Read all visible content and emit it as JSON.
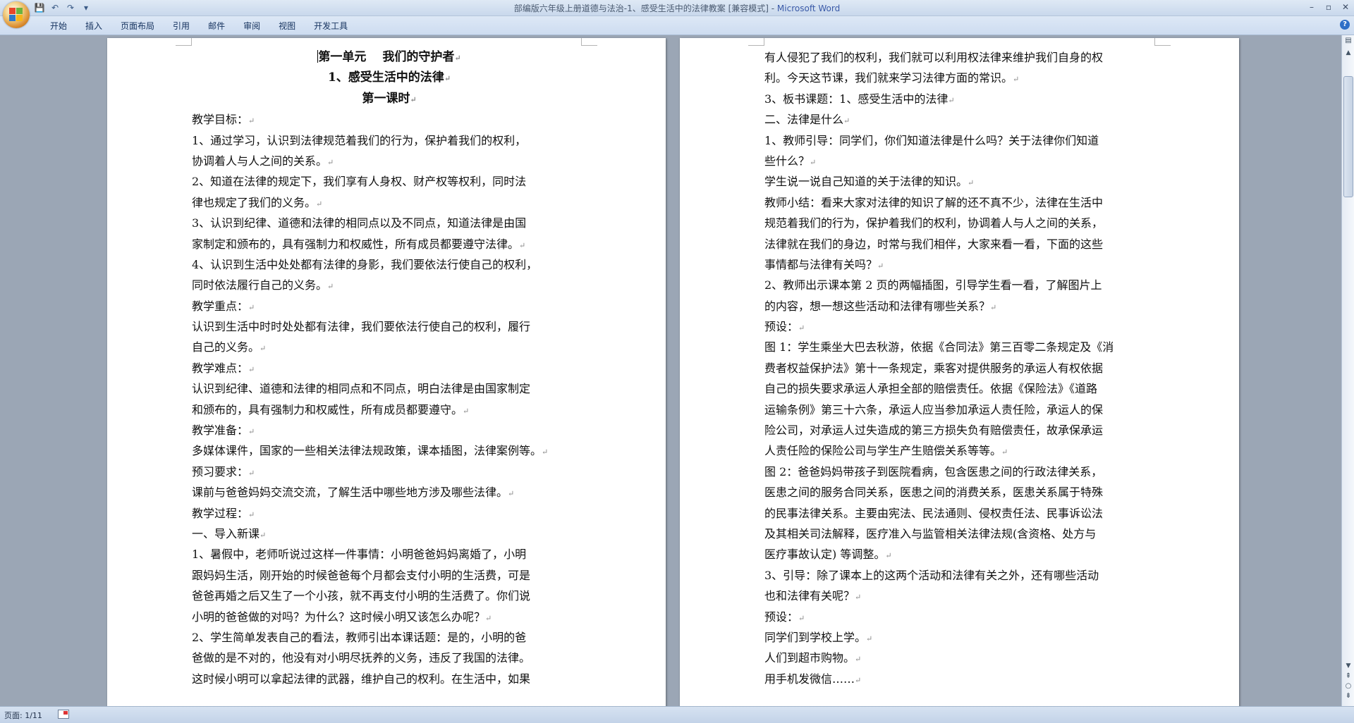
{
  "window": {
    "title_doc": "部编版六年级上册道德与法治-1、感受生活中的法律教案 [兼容模式]",
    "title_sep": " - ",
    "title_app": "Microsoft Word",
    "controls": {
      "minimize": "–",
      "restore": "▫",
      "close": "✕"
    }
  },
  "qat": {
    "save": "💾",
    "undo": "↶",
    "redo": "↷",
    "more": "▾"
  },
  "ribbon": {
    "tabs": [
      "开始",
      "插入",
      "页面布局",
      "引用",
      "邮件",
      "审阅",
      "视图",
      "开发工具"
    ],
    "help": "?"
  },
  "pages": {
    "left": [
      {
        "t": "第一单元　 我们的守护者",
        "c": true,
        "cursor": true
      },
      {
        "t": "1、感受生活中的法律",
        "c": true
      },
      {
        "t": "第一课时",
        "c": true
      },
      {
        "t": "教学目标："
      },
      {
        "t": "1、通过学习，认识到法律规范着我们的行为，保护着我们的权利，",
        "nomark": true
      },
      {
        "t": "协调着人与人之间的关系。"
      },
      {
        "t": "2、知道在法律的规定下，我们享有人身权、财产权等权利，同时法",
        "nomark": true
      },
      {
        "t": "律也规定了我们的义务。"
      },
      {
        "t": "3、认识到纪律、道德和法律的相同点以及不同点，知道法律是由国",
        "nomark": true
      },
      {
        "t": "家制定和颁布的，具有强制力和权威性，所有成员都要遵守法律。"
      },
      {
        "t": "4、认识到生活中处处都有法律的身影，我们要依法行使自己的权利，",
        "nomark": true
      },
      {
        "t": "同时依法履行自己的义务。"
      },
      {
        "t": "教学重点："
      },
      {
        "t": "认识到生活中时时处处都有法律，我们要依法行使自己的权利，履行",
        "nomark": true
      },
      {
        "t": "自己的义务。"
      },
      {
        "t": "教学难点："
      },
      {
        "t": "认识到纪律、道德和法律的相同点和不同点，明白法律是由国家制定",
        "nomark": true
      },
      {
        "t": "和颁布的，具有强制力和权威性，所有成员都要遵守。"
      },
      {
        "t": "教学准备："
      },
      {
        "t": "多媒体课件，国家的一些相关法律法规政策，课本插图，法律案例等。"
      },
      {
        "t": "预习要求："
      },
      {
        "t": "课前与爸爸妈妈交流交流，了解生活中哪些地方涉及哪些法律。"
      },
      {
        "t": "教学过程："
      },
      {
        "t": "一、导入新课"
      },
      {
        "t": "1、暑假中，老师听说过这样一件事情：小明爸爸妈妈离婚了，小明",
        "nomark": true
      },
      {
        "t": "跟妈妈生活，刚开始的时候爸爸每个月都会支付小明的生活费，可是",
        "nomark": true
      },
      {
        "t": "爸爸再婚之后又生了一个小孩，就不再支付小明的生活费了。你们说",
        "nomark": true
      },
      {
        "t": "小明的爸爸做的对吗？为什么？这时候小明又该怎么办呢？"
      },
      {
        "t": "2、学生简单发表自己的看法，教师引出本课话题：是的，小明的爸",
        "nomark": true
      },
      {
        "t": "爸做的是不对的，他没有对小明尽抚养的义务，违反了我国的法律。",
        "nomark": true
      },
      {
        "t": "这时候小明可以拿起法律的武器，维护自己的权利。在生活中，如果",
        "nomark": true
      }
    ],
    "right": [
      {
        "t": "有人侵犯了我们的权利，我们就可以利用权法律来维护我们自身的权",
        "nomark": true
      },
      {
        "t": "利。今天这节课，我们就来学习法律方面的常识。"
      },
      {
        "t": "3、板书课题：1、感受生活中的法律"
      },
      {
        "t": "二、法律是什么"
      },
      {
        "t": "1、教师引导：同学们，你们知道法律是什么吗？关于法律你们知道",
        "nomark": true
      },
      {
        "t": "些什么？"
      },
      {
        "t": "学生说一说自己知道的关于法律的知识。"
      },
      {
        "t": "教师小结：看来大家对法律的知识了解的还不真不少，法律在生活中",
        "nomark": true
      },
      {
        "t": "规范着我们的行为，保护着我们的权利，协调着人与人之间的关系，",
        "nomark": true
      },
      {
        "t": "法律就在我们的身边，时常与我们相伴，大家来看一看，下面的这些",
        "nomark": true
      },
      {
        "t": "事情都与法律有关吗？"
      },
      {
        "t": "2、教师出示课本第 2 页的两幅插图，引导学生看一看，了解图片上",
        "nomark": true
      },
      {
        "t": "的内容，想一想这些活动和法律有哪些关系？"
      },
      {
        "t": "预设："
      },
      {
        "t": "图 1：学生乘坐大巴去秋游，依据《合同法》第三百零二条规定及《消",
        "nomark": true
      },
      {
        "t": "费者权益保护法》第十一条规定，乘客对提供服务的承运人有权依据",
        "nomark": true
      },
      {
        "t": "自己的损失要求承运人承担全部的赔偿责任。依据《保险法》《道路",
        "nomark": true
      },
      {
        "t": "运输条例》第三十六条，承运人应当参加承运人责任险，承运人的保",
        "nomark": true
      },
      {
        "t": "险公司，对承运人过失造成的第三方损失负有赔偿责任，故承保承运",
        "nomark": true
      },
      {
        "t": "人责任险的保险公司与学生产生赔偿关系等等。"
      },
      {
        "t": "图 2：爸爸妈妈带孩子到医院看病，包含医患之间的行政法律关系，",
        "nomark": true
      },
      {
        "t": "医患之间的服务合同关系，医患之间的消费关系，医患关系属于特殊",
        "nomark": true
      },
      {
        "t": "的民事法律关系。主要由宪法、民法通则、侵权责任法、民事诉讼法",
        "nomark": true
      },
      {
        "t": "及其相关司法解释，医疗准入与监管相关法律法规(含资格、处方与",
        "nomark": true
      },
      {
        "t": "医疗事故认定) 等调整。"
      },
      {
        "t": "3、引导：除了课本上的这两个活动和法律有关之外，还有哪些活动",
        "nomark": true
      },
      {
        "t": "也和法律有关呢？"
      },
      {
        "t": "预设："
      },
      {
        "t": "同学们到学校上学。"
      },
      {
        "t": "人们到超市购物。"
      },
      {
        "t": "用手机发微信……"
      }
    ],
    "para_mark": "↵"
  },
  "statusbar": {
    "page": "页面: 1/11"
  },
  "colors": {
    "background": "#9ba6b5",
    "page": "#ffffff",
    "title_app": "#3a5aa8"
  }
}
